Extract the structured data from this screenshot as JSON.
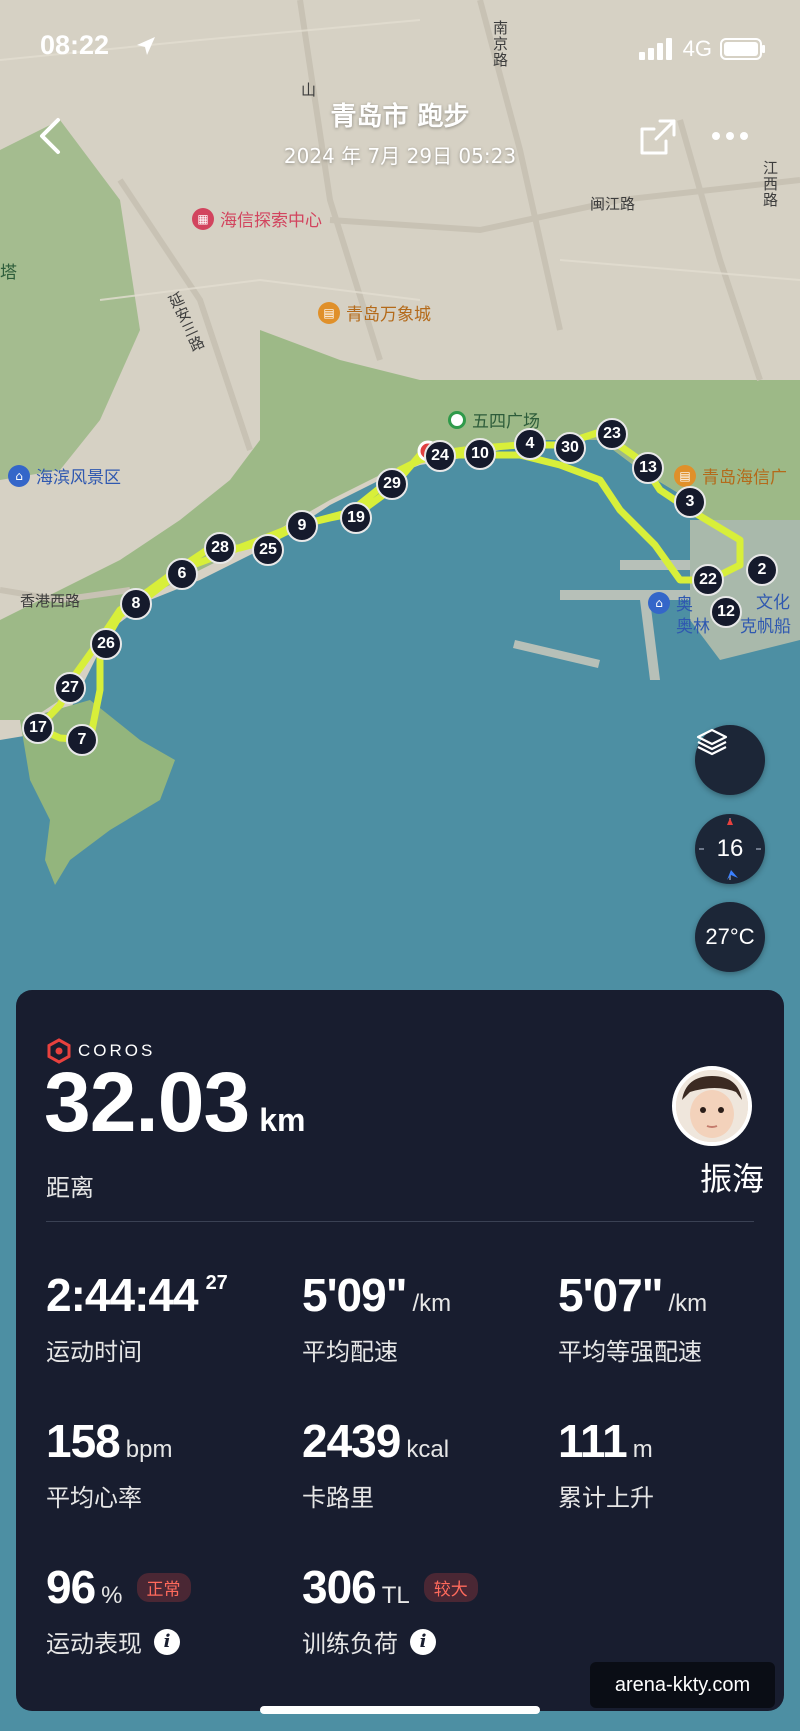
{
  "status_bar": {
    "time": "08:22",
    "network": "4G"
  },
  "header": {
    "title": "青岛市 跑步",
    "subtitle": "2024 年 7月 29日 05:23"
  },
  "map": {
    "roads": [
      "南京路",
      "闽江路",
      "江西路",
      "山",
      "延安三路",
      "香港西路"
    ],
    "pois": {
      "haixin_explore": "海信探索中心",
      "mixc": "青岛万象城",
      "may_fourth": "五四广场",
      "seaside": "海滨风景区",
      "hisense_plaza": "青岛海信广",
      "olympic_1": "奥",
      "olympic_2": "奥林",
      "olympic_culture": "文化",
      "sailing": "克帆船",
      "tower": "塔"
    },
    "km_markers": [
      "17",
      "7",
      "27",
      "26",
      "8",
      "6",
      "28",
      "25",
      "9",
      "19",
      "29",
      "24",
      "10",
      "4",
      "30",
      "23",
      "13",
      "3",
      "2",
      "22",
      "12"
    ],
    "route_color": "#d8ef3a",
    "compass": "16",
    "temperature": "27°C"
  },
  "card": {
    "brand": "COROS",
    "distance": {
      "value": "32.03",
      "unit": "km",
      "label": "距离"
    },
    "user_name": "振海",
    "stats": {
      "time": {
        "value": "2:44:44",
        "sup": "27",
        "label": "运动时间"
      },
      "pace": {
        "value": "5'09\"",
        "unit": "/km",
        "label": "平均配速"
      },
      "grade_pace": {
        "value": "5'07\"",
        "unit": "/km",
        "label": "平均等强配速"
      },
      "heart_rate": {
        "value": "158",
        "unit": "bpm",
        "label": "平均心率"
      },
      "calories": {
        "value": "2439",
        "unit": "kcal",
        "label": "卡路里"
      },
      "ascent": {
        "value": "111",
        "unit": "m",
        "label": "累计上升"
      },
      "performance": {
        "value": "96",
        "unit": "%",
        "badge": "正常",
        "label": "运动表现"
      },
      "load": {
        "value": "306",
        "unit": "TL",
        "badge": "较大",
        "label": "训练负荷"
      }
    }
  },
  "watermark": "arena-kkty.com",
  "colors": {
    "card_bg": "#181d2f",
    "sea": "#4d8fa3",
    "land": "#d6d1c4",
    "park": "#8fb07a",
    "route": "#d8ef3a",
    "brand_red": "#e8413e"
  }
}
